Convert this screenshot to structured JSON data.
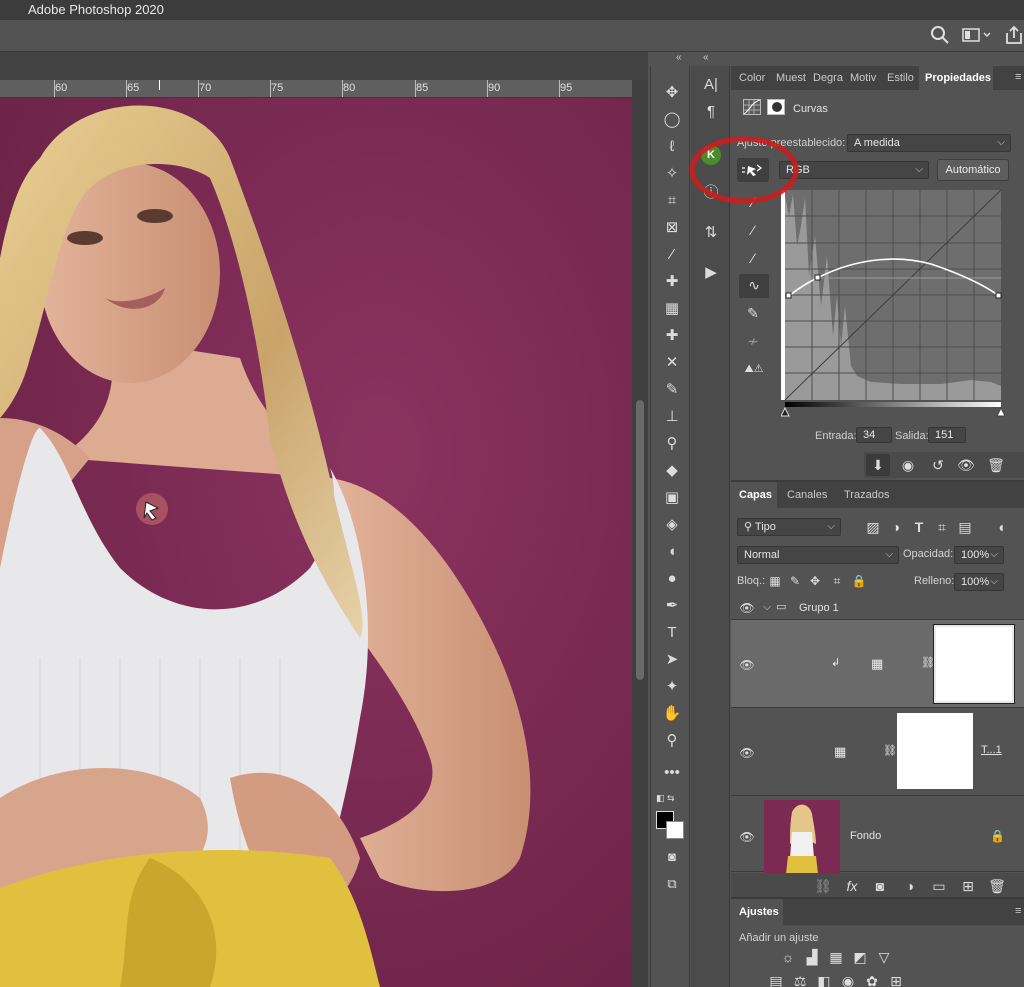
{
  "app": {
    "title": "Adobe Photoshop 2020"
  },
  "ruler": {
    "labels": [
      "60",
      "65",
      "70",
      "75",
      "80",
      "85",
      "90",
      "95"
    ]
  },
  "properties": {
    "tabs": [
      "Color",
      "Muest",
      "Degra",
      "Motiv",
      "Estilo",
      "Propiedades"
    ],
    "active_tab": "Propiedades",
    "panel_title": "Curvas",
    "preset_label": "Ajuste preestablecido:",
    "preset_value": "A medida",
    "channel_value": "RGB",
    "auto_button": "Automático",
    "input_label": "Entrada:",
    "input_value": "34",
    "output_label": "Salida:",
    "output_value": "151"
  },
  "layers": {
    "tabs": [
      "Capas",
      "Canales",
      "Trazados"
    ],
    "active_tab": "Capas",
    "filter_value": "Tipo",
    "blend_mode": "Normal",
    "opacity_label": "Opacidad:",
    "opacity_value": "100%",
    "lock_label": "Bloq.:",
    "fill_label": "Relleno:",
    "fill_value": "100%",
    "group_name": "Grupo 1",
    "smart_label": "T...1",
    "background_name": "Fondo"
  },
  "adjustments": {
    "title": "Ajustes",
    "subtitle": "Añadir un ajuste"
  },
  "colors": {
    "canvas_bg": "#7d2a52",
    "highlight_ring": "#d11b1b",
    "accent_green": "#4c8b2b"
  },
  "icons": {
    "search": "search-icon",
    "workspace": "workspace-icon",
    "share": "share-icon"
  }
}
